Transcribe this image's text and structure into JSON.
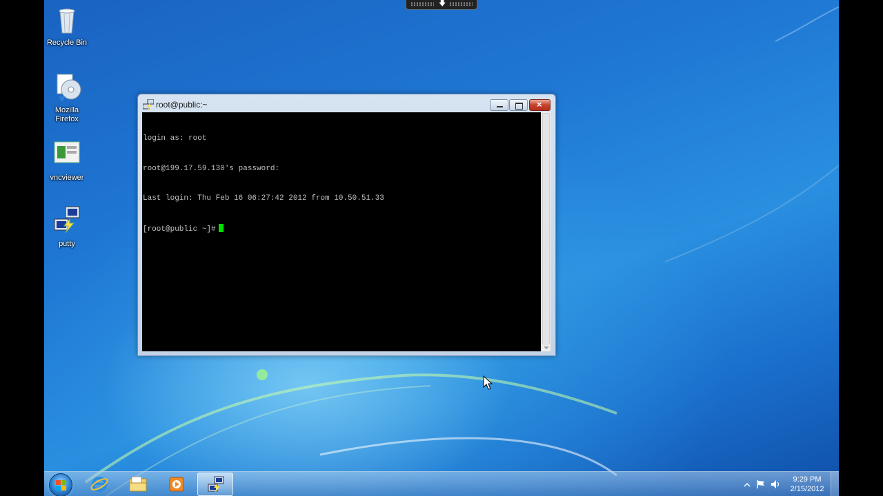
{
  "desktop_icons": [
    {
      "label": "Recycle Bin",
      "icon": "recycle-bin-icon"
    },
    {
      "label": "Mozilla Firefox",
      "icon": "firefox-icon"
    },
    {
      "label": "vncviewer",
      "icon": "vncviewer-icon"
    },
    {
      "label": "putty",
      "icon": "putty-icon"
    }
  ],
  "window": {
    "title": "root@public:~",
    "terminal_lines": [
      "login as: root",
      "root@199.17.59.130's password:",
      "Last login: Thu Feb 16 06:27:42 2012 from 10.50.51.33",
      "[root@public ~]#"
    ]
  },
  "taskbar": {
    "items": [
      {
        "icon": "internet-explorer-icon",
        "active": false
      },
      {
        "icon": "file-explorer-icon",
        "active": false
      },
      {
        "icon": "media-player-icon",
        "active": false
      },
      {
        "icon": "putty-icon",
        "active": true
      }
    ],
    "clock": {
      "time": "9:29 PM",
      "date": "2/15/2012"
    }
  },
  "colors": {
    "terminal_bg": "#000000",
    "terminal_fg": "#c0c0c0",
    "cursor": "#00e000",
    "close_button": "#c6402a"
  }
}
